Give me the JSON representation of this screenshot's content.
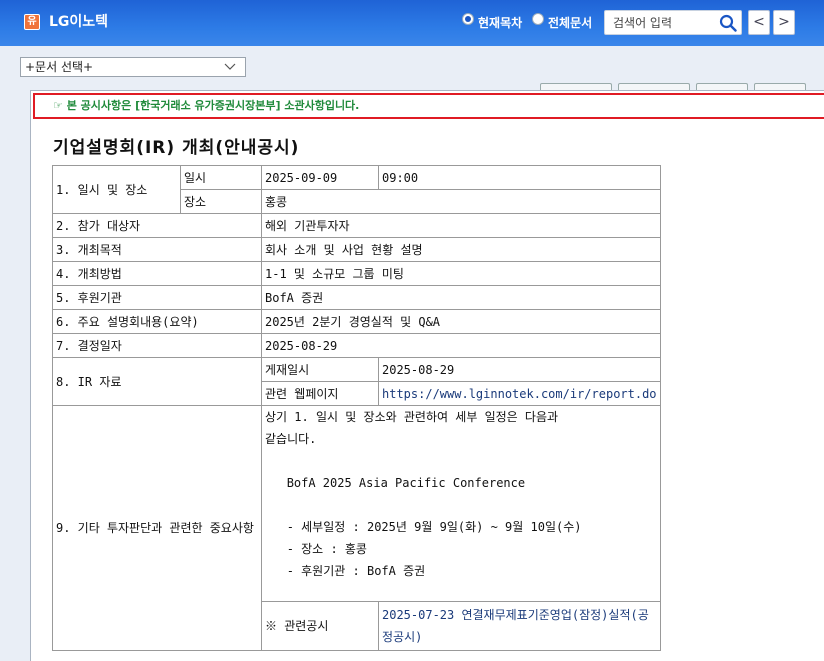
{
  "header": {
    "logo_glyph": "유",
    "company": "LG이노텍",
    "radio_current": "현재목차",
    "radio_all": "전체문서",
    "search_placeholder": "검색어 입력",
    "prev": "<",
    "next": ">"
  },
  "doc_select": {
    "value": "+문서 선택+"
  },
  "notice": "☞ 본 공시사항은 [한국거래소 유가증권시장본부] 소관사항입니다.",
  "title": "기업설명회(IR) 개최(안내공시)",
  "table": {
    "r1_label": "1. 일시 및 장소",
    "r1_date_label": "일시",
    "r1_date": "2025-09-09",
    "r1_time": "09:00",
    "r1_place_label": "장소",
    "r1_place": "홍콩",
    "r2_label": "2. 참가 대상자",
    "r2_value": "해외 기관투자자",
    "r3_label": "3. 개최목적",
    "r3_value": "회사 소개 및 사업 현황 설명",
    "r4_label": "4. 개최방법",
    "r4_value": "1-1 및 소규모 그룹 미팅",
    "r5_label": "5. 후원기관",
    "r5_value": "BofA 증권",
    "r6_label": "6. 주요 설명회내용(요약)",
    "r6_value": "2025년 2분기 경영실적 및 Q&A",
    "r7_label": "7. 결정일자",
    "r7_value": "2025-08-29",
    "r8_label": "8. IR 자료",
    "r8_post_label": "게재일시",
    "r8_post": "2025-08-29",
    "r8_web_label": "관련 웹페이지",
    "r8_web": "https://www.lginnotek.com/ir/report.do",
    "r9_label": "9. 기타 투자판단과 관련한 중요사항",
    "r9_text": "상기 1. 일시 및 장소와 관련하여 세부 일정은 다음과\n같습니다.\n\n   BofA 2025 Asia Pacific Conference\n\n   - 세부일정 : 2025년 9월 9일(화) ~ 9월 10일(수)\n   - 장소 : 홍콩\n   - 후원기관 : BofA 증권",
    "related_label": "※ 관련공시",
    "related_value": "2025-07-23 연결재무제표기준영업(잠정)실적(공정공시)"
  }
}
